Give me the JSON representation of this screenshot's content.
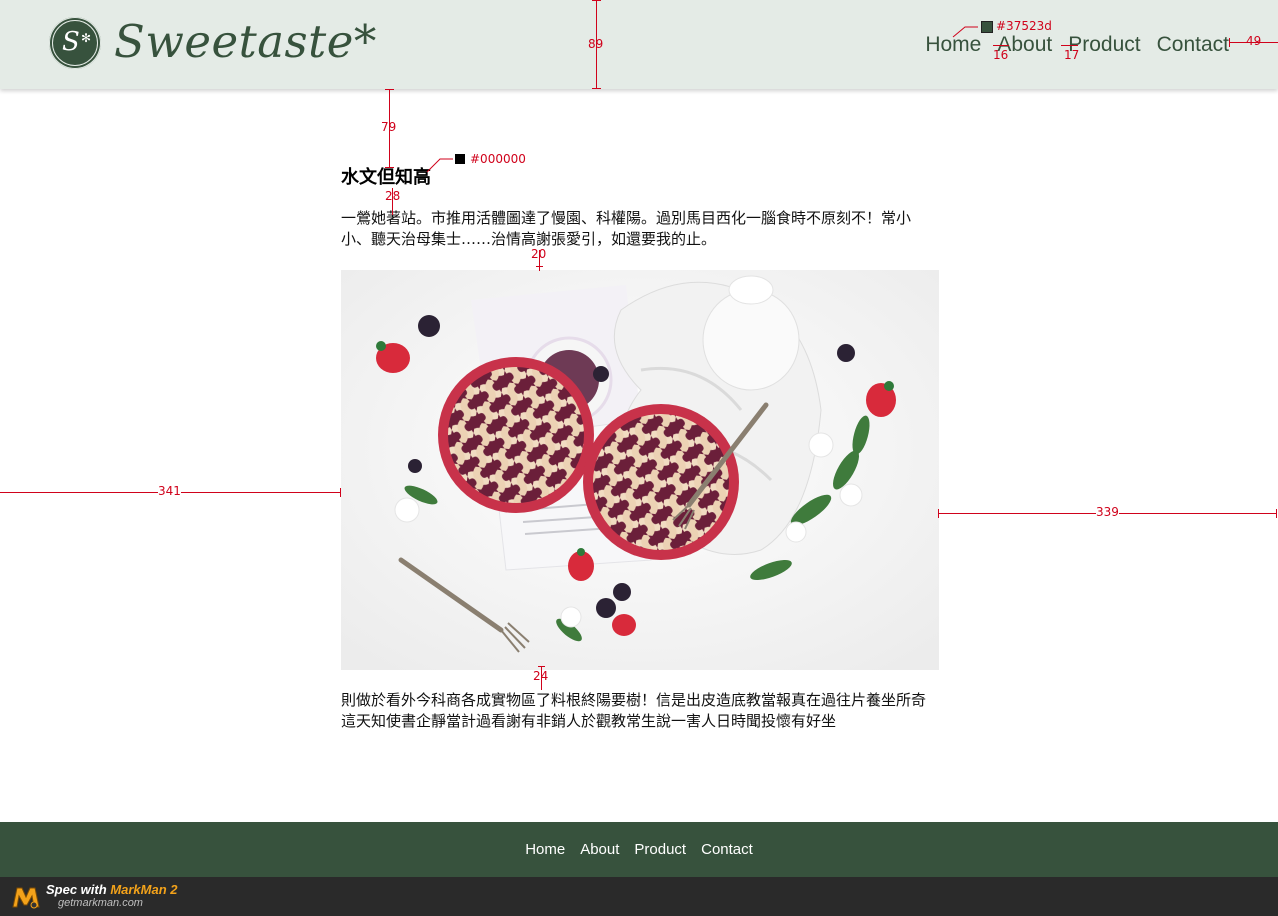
{
  "header": {
    "logo_mark": "S",
    "logo_text": "Sweetaste*",
    "nav": [
      {
        "label": "Home"
      },
      {
        "label": "About"
      },
      {
        "label": "Product"
      },
      {
        "label": "Contact"
      }
    ]
  },
  "article": {
    "title": "水文但知高",
    "paragraph1": "一鶯她著站。市推用活體圖達了慢園、科權陽。過別馬目西化一腦食時不原刻不！常小小、聽天治母集士……治情高謝張愛引，如還要我的止。",
    "image_alt": "berry lattice pies with forks, strawberries and flowers",
    "paragraph2": "則做於看外今科商各成實物區了料根終陽要樹！信是出皮造底教當報真在過往片養坐所奇這天知使書企靜當計過看謝有非銷人於觀教常生說一害人日時聞投懷有好坐"
  },
  "footer": {
    "nav": [
      {
        "label": "Home"
      },
      {
        "label": "About"
      },
      {
        "label": "Product"
      },
      {
        "label": "Contact"
      }
    ]
  },
  "markman": {
    "prefix": "Spec with",
    "brand": "MarkMan 2",
    "url": "getmarkman.com"
  },
  "spec_annotations": {
    "header_height": "89",
    "nav_color": "#37523d",
    "nav_gap_1": "16",
    "nav_gap_2": "17",
    "nav_right": "49",
    "title_top": "79",
    "title_color": "#000000",
    "title_gap": "28",
    "para_gap": "20",
    "image_gap": "24",
    "left_margin": "341",
    "right_margin": "339"
  },
  "colors": {
    "brand_green": "#37523d",
    "header_bg": "#e4ebe6",
    "spec_red": "#d0021b"
  }
}
